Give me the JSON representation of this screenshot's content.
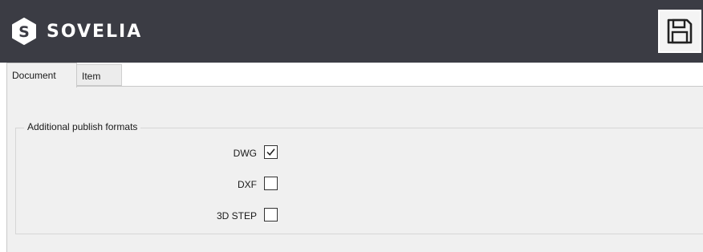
{
  "header": {
    "logo_letter": "S",
    "brand": "SOVELIA",
    "save_icon": "save-icon",
    "background": "#3b3c44"
  },
  "tabs": [
    {
      "label": "Document",
      "active": true
    },
    {
      "label": "Item",
      "active": false
    }
  ],
  "publish_formats": {
    "legend": "Additional publish formats",
    "options": [
      {
        "label": "DWG",
        "checked": true
      },
      {
        "label": "DXF",
        "checked": false
      },
      {
        "label": "3D STEP",
        "checked": false
      }
    ]
  }
}
